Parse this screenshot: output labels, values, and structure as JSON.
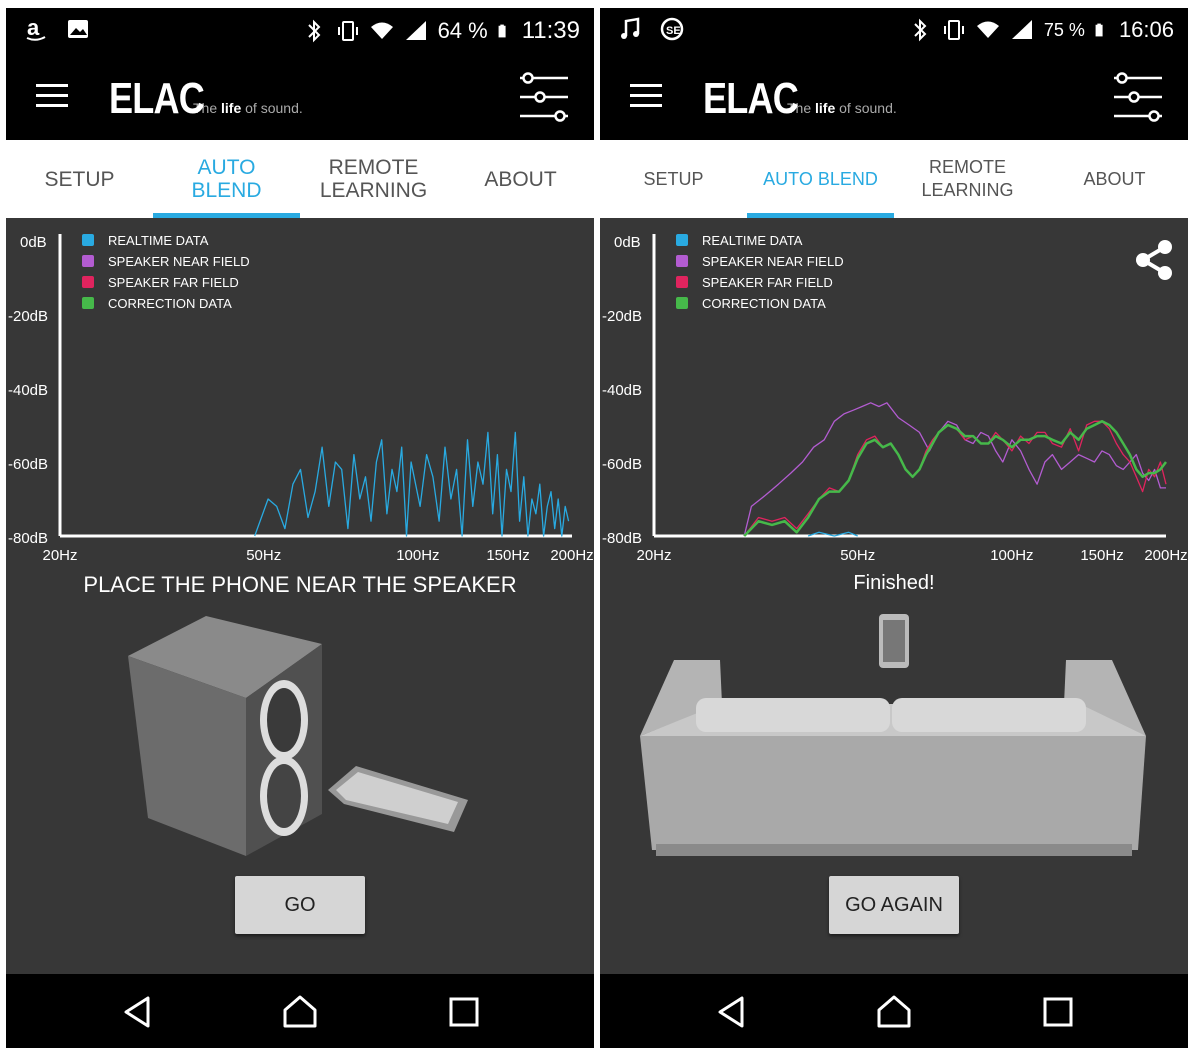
{
  "colors": {
    "accent": "#29aae1",
    "realtime": "#29aae1",
    "near_field": "#b35cd1",
    "far_field": "#e0245e",
    "correction": "#46b94a",
    "background": "#373737",
    "bars": "#000000"
  },
  "icons": {
    "menu": "hamburger-menu-icon",
    "settings": "sliders-icon",
    "share": "share-icon",
    "nav_back": "back-triangle-icon",
    "nav_home": "home-icon",
    "nav_recents": "recents-square-icon"
  },
  "left": {
    "status": {
      "battery": "64 %",
      "time": "11:39"
    },
    "brand": {
      "tag_pre": "The ",
      "tag_bold": "life",
      "tag_post": " of sound."
    },
    "tabs": [
      "SETUP",
      "AUTO\nBLEND",
      "REMOTE\nLEARNING",
      "ABOUT"
    ],
    "active_tab": 1,
    "message": "PLACE THE PHONE NEAR THE SPEAKER",
    "button": "GO"
  },
  "right": {
    "status": {
      "battery": "75 %",
      "time": "16:06"
    },
    "brand": {
      "tag_pre": "The ",
      "tag_bold": "life",
      "tag_post": " of sound."
    },
    "tabs": [
      "SETUP",
      "AUTO BLEND",
      "REMOTE\nLEARNING",
      "ABOUT"
    ],
    "active_tab": 1,
    "message": "Finished!",
    "button": "GO AGAIN"
  },
  "chart_data": [
    {
      "type": "line",
      "xscale": "log",
      "xlim": [
        20,
        200
      ],
      "ylim": [
        -80,
        0
      ],
      "yticks": [
        "0dB",
        "-20dB",
        "-40dB",
        "-60dB",
        "-80dB"
      ],
      "xticks": [
        "20Hz",
        "50Hz",
        "100Hz",
        "150Hz",
        "200Hz"
      ],
      "legend_position": "top-left",
      "series": [
        {
          "name": "REALTIME DATA",
          "x": [
            48,
            51,
            53,
            55,
            57,
            59,
            61,
            63,
            65,
            67,
            69,
            71,
            73,
            75,
            77,
            79,
            81,
            83,
            85,
            87,
            89,
            91,
            93,
            95,
            97,
            99,
            101,
            104,
            107,
            110,
            113,
            116,
            119,
            122,
            125,
            128,
            131,
            134,
            137,
            140,
            143,
            146,
            149,
            152,
            155,
            158,
            161,
            164,
            167,
            170,
            173,
            176,
            179,
            182,
            185,
            188,
            191,
            194,
            197
          ],
          "y": [
            -80,
            -70,
            -72,
            -78,
            -66,
            -62,
            -75,
            -68,
            -56,
            -72,
            -60,
            -62,
            -78,
            -58,
            -70,
            -64,
            -76,
            -60,
            -54,
            -74,
            -62,
            -68,
            -56,
            -80,
            -60,
            -66,
            -72,
            -58,
            -64,
            -76,
            -56,
            -70,
            -62,
            -80,
            -54,
            -72,
            -60,
            -66,
            -52,
            -74,
            -58,
            -80,
            -62,
            -68,
            -52,
            -76,
            -64,
            -80,
            -70,
            -74,
            -66,
            -80,
            -72,
            -68,
            -78,
            -70,
            -80,
            -72,
            -76
          ]
        },
        {
          "name": "SPEAKER NEAR FIELD",
          "x": [],
          "y": []
        },
        {
          "name": "SPEAKER FAR FIELD",
          "x": [],
          "y": []
        },
        {
          "name": "CORRECTION DATA",
          "x": [],
          "y": []
        }
      ]
    },
    {
      "type": "line",
      "xscale": "log",
      "xlim": [
        20,
        200
      ],
      "ylim": [
        -80,
        0
      ],
      "yticks": [
        "0dB",
        "-20dB",
        "-40dB",
        "-60dB",
        "-80dB"
      ],
      "xticks": [
        "20Hz",
        "50Hz",
        "100Hz",
        "150Hz",
        "200Hz"
      ],
      "legend_position": "top-left",
      "series": [
        {
          "name": "REALTIME DATA",
          "x": [
            40,
            42,
            45,
            48,
            50
          ],
          "y": [
            -80,
            -79,
            -80,
            -79,
            -80
          ]
        },
        {
          "name": "SPEAKER NEAR FIELD",
          "x": [
            30,
            31,
            33,
            35,
            37,
            39,
            41,
            43,
            45,
            47,
            49,
            51,
            53,
            55,
            57,
            60,
            63,
            66,
            69,
            72,
            75,
            78,
            81,
            84,
            87,
            90,
            93,
            96,
            100,
            104,
            108,
            112,
            116,
            120,
            125,
            130,
            135,
            140,
            145,
            150,
            155,
            160,
            165,
            170,
            175,
            180,
            185,
            190,
            195,
            200
          ],
          "y": [
            -80,
            -72,
            -69,
            -66,
            -63,
            -60,
            -56,
            -54,
            -49,
            -47,
            -46,
            -45,
            -44,
            -45,
            -44,
            -48,
            -50,
            -52,
            -57,
            -52,
            -49,
            -50,
            -54,
            -55,
            -52,
            -53,
            -57,
            -60,
            -54,
            -57,
            -62,
            -66,
            -60,
            -58,
            -62,
            -60,
            -58,
            -59,
            -60,
            -57,
            -58,
            -61,
            -62,
            -60,
            -58,
            -63,
            -65,
            -62,
            -67,
            -67
          ]
        },
        {
          "name": "SPEAKER FAR FIELD",
          "x": [
            30,
            32,
            34,
            36,
            38,
            40,
            42,
            44,
            46,
            48,
            50,
            52,
            54,
            56,
            58,
            60,
            62,
            64,
            66,
            68,
            70,
            72,
            75,
            78,
            81,
            84,
            87,
            90,
            93,
            96,
            100,
            104,
            108,
            112,
            116,
            120,
            125,
            130,
            135,
            140,
            145,
            150,
            155,
            160,
            165,
            170,
            175,
            180,
            185,
            190,
            195,
            200
          ],
          "y": [
            -80,
            -75,
            -76,
            -75,
            -78,
            -74,
            -70,
            -67,
            -68,
            -65,
            -58,
            -54,
            -53,
            -56,
            -55,
            -58,
            -62,
            -64,
            -62,
            -57,
            -54,
            -52,
            -50,
            -51,
            -54,
            -53,
            -55,
            -55,
            -52,
            -54,
            -57,
            -53,
            -55,
            -52,
            -52,
            -55,
            -56,
            -51,
            -57,
            -50,
            -49,
            -49,
            -51,
            -55,
            -58,
            -60,
            -64,
            -68,
            -62,
            -64,
            -60,
            -66
          ]
        },
        {
          "name": "CORRECTION DATA",
          "x": [
            30,
            32,
            34,
            36,
            38,
            40,
            42,
            44,
            46,
            48,
            50,
            52,
            54,
            56,
            58,
            60,
            62,
            64,
            66,
            68,
            70,
            72,
            75,
            78,
            81,
            84,
            87,
            90,
            93,
            96,
            100,
            104,
            108,
            112,
            116,
            120,
            125,
            130,
            135,
            140,
            145,
            150,
            155,
            160,
            165,
            170,
            175,
            180,
            185,
            190,
            195,
            200
          ],
          "y": [
            -80,
            -76,
            -77,
            -76,
            -79,
            -75,
            -70,
            -68,
            -68,
            -65,
            -59,
            -55,
            -54,
            -56,
            -55,
            -58,
            -62,
            -64,
            -62,
            -58,
            -55,
            -52,
            -50,
            -51,
            -53,
            -53,
            -55,
            -55,
            -53,
            -54,
            -56,
            -54,
            -54,
            -53,
            -53,
            -54,
            -55,
            -52,
            -54,
            -51,
            -50,
            -49,
            -50,
            -52,
            -55,
            -58,
            -62,
            -64,
            -63,
            -63,
            -62,
            -60
          ]
        }
      ]
    }
  ]
}
